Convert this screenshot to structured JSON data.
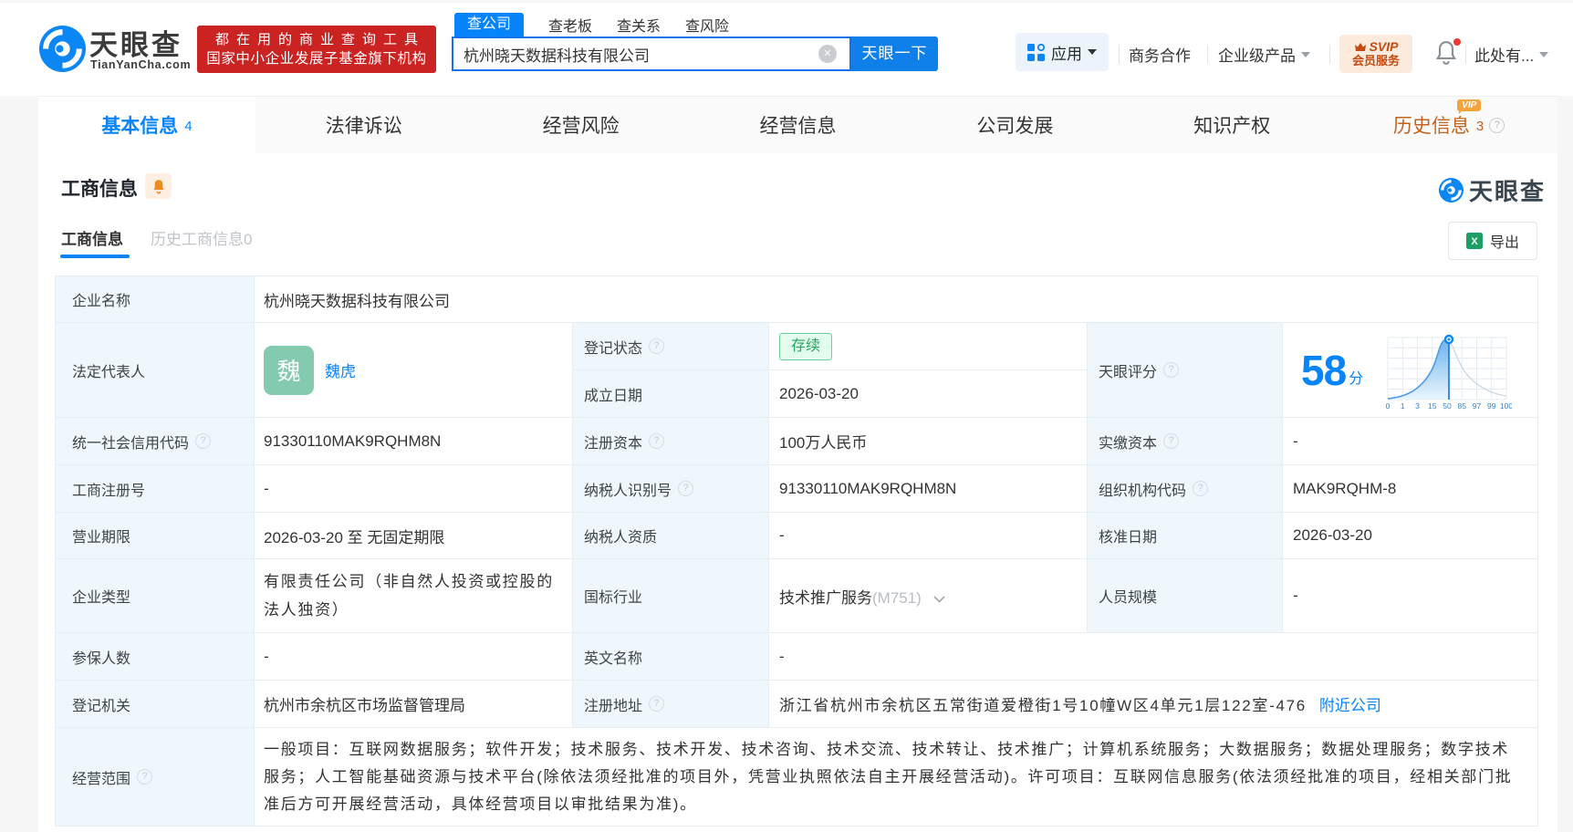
{
  "header": {
    "brand": {
      "name": "天眼查",
      "domain": "TianYanCha.com"
    },
    "slogan_line1": "都在用的商业查询工具",
    "slogan_line2": "国家中小企业发展子基金旗下机构",
    "search": {
      "tabs": [
        "查公司",
        "查老板",
        "查关系",
        "查风险"
      ],
      "value": "杭州晓天数据科技有限公司",
      "button": "天眼一下"
    },
    "menu": {
      "apps": "应用",
      "cooperation": "商务合作",
      "enterprise": "企业级产品",
      "svip_line1": "SVIP",
      "svip_line2": "会员服务",
      "user": "此处有..."
    }
  },
  "nav": {
    "tabs": [
      {
        "label": "基本信息",
        "count": "4"
      },
      {
        "label": "法律诉讼"
      },
      {
        "label": "经营风险"
      },
      {
        "label": "经营信息"
      },
      {
        "label": "公司发展"
      },
      {
        "label": "知识产权"
      },
      {
        "label": "历史信息",
        "count": "3",
        "vip": "VIP"
      }
    ]
  },
  "section": {
    "title": "工商信息",
    "subtab_active": "工商信息",
    "subtab_history": "历史工商信息0",
    "export_label": "导出",
    "watermark": "天眼查"
  },
  "fields": {
    "name": {
      "label": "企业名称",
      "value": "杭州晓天数据科技有限公司"
    },
    "legal_rep": {
      "label": "法定代表人",
      "avatar": "魏",
      "value": "魏虎"
    },
    "reg_status": {
      "label": "登记状态",
      "value": "存续"
    },
    "est_date": {
      "label": "成立日期",
      "value": "2026-03-20"
    },
    "score": {
      "label": "天眼评分",
      "value": "58",
      "unit": "分"
    },
    "uscc": {
      "label": "统一社会信用代码",
      "value": "91330110MAK9RQHM8N"
    },
    "reg_capital": {
      "label": "注册资本",
      "value": "100万人民币"
    },
    "paid_capital": {
      "label": "实缴资本",
      "value": "-"
    },
    "reg_no": {
      "label": "工商注册号",
      "value": "-"
    },
    "taxpayer_id": {
      "label": "纳税人识别号",
      "value": "91330110MAK9RQHM8N"
    },
    "org_code": {
      "label": "组织机构代码",
      "value": "MAK9RQHM-8"
    },
    "term": {
      "label": "营业期限",
      "value": "2026-03-20 至 无固定期限"
    },
    "taxpayer_qual": {
      "label": "纳税人资质",
      "value": "-"
    },
    "approval_date": {
      "label": "核准日期",
      "value": "2026-03-20"
    },
    "company_type": {
      "label": "企业类型",
      "value": "有限责任公司（非自然人投资或控股的法人独资）"
    },
    "industry": {
      "label": "国标行业",
      "value": "技术推广服务",
      "code": "(M751)"
    },
    "staff_size": {
      "label": "人员规模",
      "value": "-"
    },
    "insured": {
      "label": "参保人数",
      "value": "-"
    },
    "english_name": {
      "label": "英文名称",
      "value": "-"
    },
    "reg_authority": {
      "label": "登记机关",
      "value": "杭州市余杭区市场监督管理局"
    },
    "address": {
      "label": "注册地址",
      "value": "浙江省杭州市余杭区五常街道爱橙街1号10幢W区4单元1层122室-476",
      "link": "附近公司"
    },
    "business_scope": {
      "label": "经营范围",
      "value": "一般项目：互联网数据服务；软件开发；技术服务、技术开发、技术咨询、技术交流、技术转让、技术推广；计算机系统服务；大数据服务；数据处理服务；数字技术服务；人工智能基础资源与技术平台(除依法须经批准的项目外，凭营业执照依法自主开展经营活动)。许可项目：互联网信息服务(依法须经批准的项目，经相关部门批准后方可开展经营活动，具体经营项目以审批结果为准)。"
    }
  },
  "chart_data": {
    "type": "area",
    "title": "天眼评分",
    "score": 58,
    "x_ticks": [
      "0",
      "1",
      "3",
      "15",
      "50",
      "85",
      "97",
      "99",
      "100"
    ]
  }
}
